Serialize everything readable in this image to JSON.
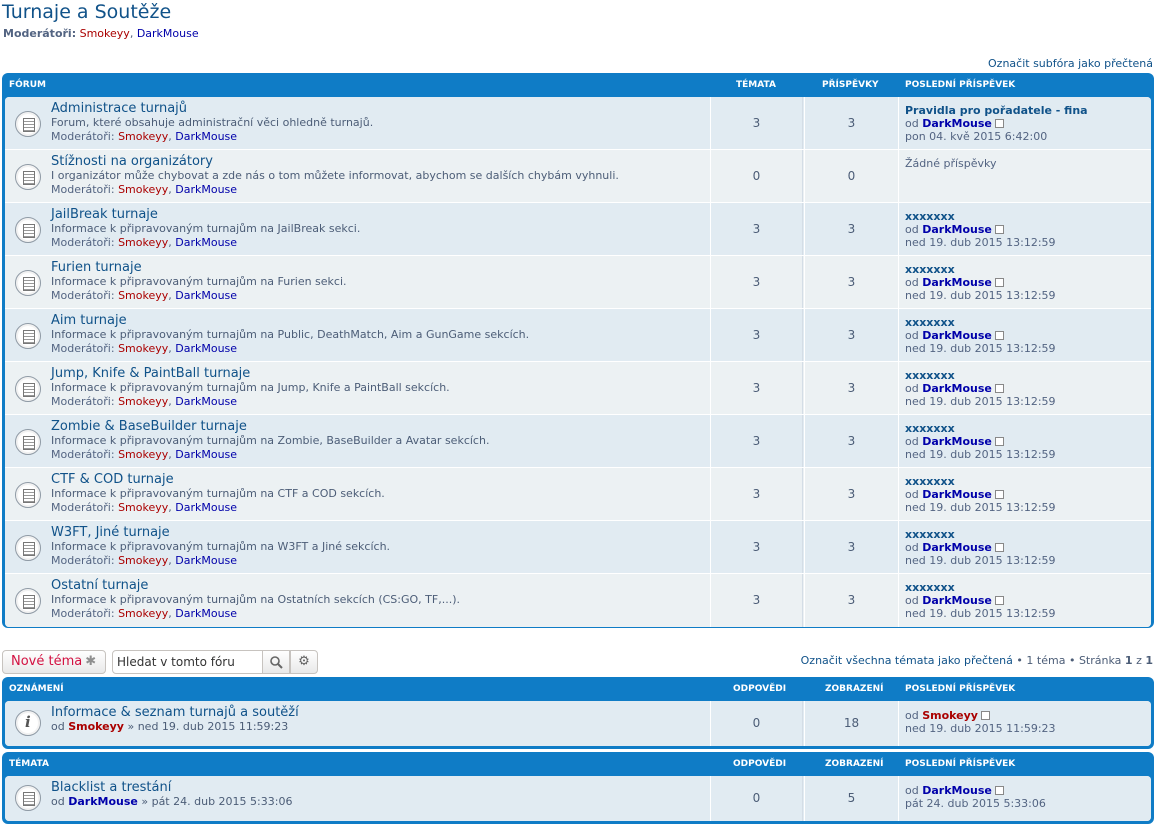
{
  "page": {
    "title": "Turnaje a Soutěže",
    "moderators_label": "Moderátoři:",
    "moderators": [
      "Smokeyy",
      "DarkMouse"
    ],
    "mark_subforums_read": "Označit subfóra jako přečtená"
  },
  "forums_table": {
    "headers": {
      "forum": "Fórum",
      "topics": "Témata",
      "posts": "Příspěvky",
      "last_post": "Poslední příspěvek"
    },
    "rows": [
      {
        "title": "Administrace turnajů",
        "desc": "Forum, které obsahuje administrační věci ohledně turnajů.",
        "topics": "3",
        "posts": "3",
        "last_title": "Pravidla pro pořadatele - fina",
        "last_by": "DarkMouse",
        "last_date": "pon 04. kvě 2015 6:42:00"
      },
      {
        "title": "Stížnosti na organizátory",
        "desc": "I organizátor může chybovat a zde nás o tom můžete informovat, abychom se dalších chybám vyhnuli.",
        "topics": "0",
        "posts": "0",
        "no_posts": "Žádné příspěvky"
      },
      {
        "title": "JailBreak turnaje",
        "desc": "Informace k připravovaným turnajům na JailBreak sekci.",
        "topics": "3",
        "posts": "3",
        "last_title": "xxxxxxx",
        "last_by": "DarkMouse",
        "last_date": "ned 19. dub 2015 13:12:59"
      },
      {
        "title": "Furien turnaje",
        "desc": "Informace k připravovaným turnajům na Furien sekci.",
        "topics": "3",
        "posts": "3",
        "last_title": "xxxxxxx",
        "last_by": "DarkMouse",
        "last_date": "ned 19. dub 2015 13:12:59"
      },
      {
        "title": "Aim turnaje",
        "desc": "Informace k připravovaným turnajům na Public, DeathMatch, Aim a GunGame sekcích.",
        "topics": "3",
        "posts": "3",
        "last_title": "xxxxxxx",
        "last_by": "DarkMouse",
        "last_date": "ned 19. dub 2015 13:12:59"
      },
      {
        "title": "Jump, Knife & PaintBall turnaje",
        "desc": "Informace k připravovaným turnajům na Jump, Knife a PaintBall sekcích.",
        "topics": "3",
        "posts": "3",
        "last_title": "xxxxxxx",
        "last_by": "DarkMouse",
        "last_date": "ned 19. dub 2015 13:12:59"
      },
      {
        "title": "Zombie & BaseBuilder turnaje",
        "desc": "Informace k připravovaným turnajům na Zombie, BaseBuilder a Avatar sekcích.",
        "topics": "3",
        "posts": "3",
        "last_title": "xxxxxxx",
        "last_by": "DarkMouse",
        "last_date": "ned 19. dub 2015 13:12:59"
      },
      {
        "title": "CTF & COD turnaje",
        "desc": "Informace k připravovaným turnajům na CTF a COD sekcích.",
        "topics": "3",
        "posts": "3",
        "last_title": "xxxxxxx",
        "last_by": "DarkMouse",
        "last_date": "ned 19. dub 2015 13:12:59"
      },
      {
        "title": "W3FT, Jiné turnaje",
        "desc": "Informace k připravovaným turnajům na W3FT a Jiné sekcích.",
        "topics": "3",
        "posts": "3",
        "last_title": "xxxxxxx",
        "last_by": "DarkMouse",
        "last_date": "ned 19. dub 2015 13:12:59"
      },
      {
        "title": "Ostatní turnaje",
        "desc": "Informace k připravovaným turnajům na Ostatních sekcích (CS:GO, TF,...).",
        "topics": "3",
        "posts": "3",
        "last_title": "xxxxxxx",
        "last_by": "DarkMouse",
        "last_date": "ned 19. dub 2015 13:12:59"
      }
    ]
  },
  "by_label": "od",
  "toolbar": {
    "new_topic": "Nové téma",
    "search_value": "Hledat v tomto fóru",
    "search_icon": "search-icon",
    "advanced_icon": "gear-icon"
  },
  "pagination": {
    "mark_topics_read": "Označit všechna témata jako přečtená",
    "sep": "•",
    "topic_count": "1 téma",
    "page_label": "Stránka",
    "current": "1",
    "of": "z",
    "total": "1"
  },
  "announcements": {
    "headers": {
      "title": "Oznámení",
      "replies": "Odpovědi",
      "views": "Zobrazení",
      "last_post": "Poslední příspěvek"
    },
    "rows": [
      {
        "title": "Informace & seznam turnajů a soutěží",
        "author": "Smokeyy",
        "date": "» ned 19. dub 2015 11:59:23",
        "replies": "0",
        "views": "18",
        "last_by": "Smokeyy",
        "last_date": "ned 19. dub 2015 11:59:23"
      }
    ]
  },
  "topics": {
    "headers": {
      "title": "Témata",
      "replies": "Odpovědi",
      "views": "Zobrazení",
      "last_post": "Poslední příspěvek"
    },
    "rows": [
      {
        "title": "Blacklist a trestání",
        "author": "DarkMouse",
        "date": "» pát 24. dub 2015 5:33:06",
        "replies": "0",
        "views": "5",
        "last_by": "DarkMouse",
        "last_date": "pát 24. dub 2015 5:33:06"
      }
    ]
  },
  "colors": {
    "header_blue": "#0f7cc6",
    "title_blue": "#105289",
    "mod_red": "#AA0000",
    "mod_blue": "#0000AA",
    "new_topic_red": "#d31141"
  }
}
